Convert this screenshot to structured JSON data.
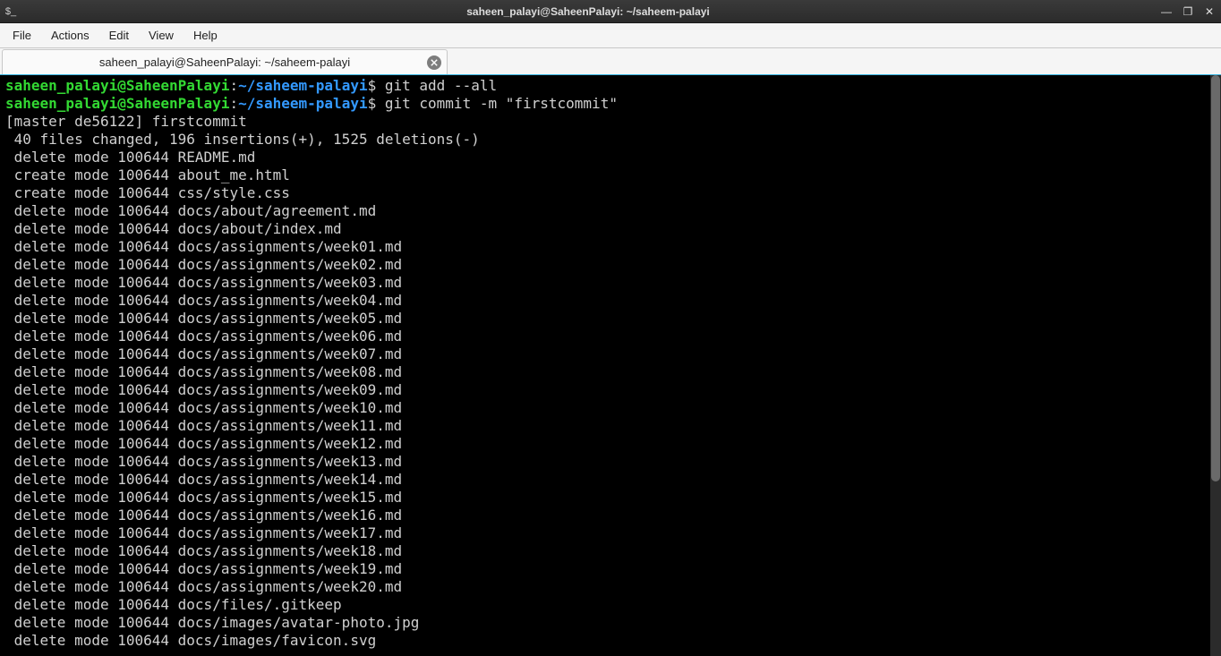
{
  "window_title": "saheen_palayi@SaheenPalayi: ~/saheem-palayi",
  "menubar": [
    {
      "label": "File"
    },
    {
      "label": "Actions"
    },
    {
      "label": "Edit"
    },
    {
      "label": "View"
    },
    {
      "label": "Help"
    }
  ],
  "tab": {
    "label": "saheen_palayi@SaheenPalayi: ~/saheem-palayi"
  },
  "prompt": {
    "user": "saheen_palayi",
    "host": "SaheenPalayi",
    "path": "~/saheem-palayi",
    "dollar": "$"
  },
  "commands": [
    "git add --all",
    "git commit -m \"firstcommit\""
  ],
  "output": [
    "[master de56122] firstcommit",
    " 40 files changed, 196 insertions(+), 1525 deletions(-)",
    " delete mode 100644 README.md",
    " create mode 100644 about_me.html",
    " create mode 100644 css/style.css",
    " delete mode 100644 docs/about/agreement.md",
    " delete mode 100644 docs/about/index.md",
    " delete mode 100644 docs/assignments/week01.md",
    " delete mode 100644 docs/assignments/week02.md",
    " delete mode 100644 docs/assignments/week03.md",
    " delete mode 100644 docs/assignments/week04.md",
    " delete mode 100644 docs/assignments/week05.md",
    " delete mode 100644 docs/assignments/week06.md",
    " delete mode 100644 docs/assignments/week07.md",
    " delete mode 100644 docs/assignments/week08.md",
    " delete mode 100644 docs/assignments/week09.md",
    " delete mode 100644 docs/assignments/week10.md",
    " delete mode 100644 docs/assignments/week11.md",
    " delete mode 100644 docs/assignments/week12.md",
    " delete mode 100644 docs/assignments/week13.md",
    " delete mode 100644 docs/assignments/week14.md",
    " delete mode 100644 docs/assignments/week15.md",
    " delete mode 100644 docs/assignments/week16.md",
    " delete mode 100644 docs/assignments/week17.md",
    " delete mode 100644 docs/assignments/week18.md",
    " delete mode 100644 docs/assignments/week19.md",
    " delete mode 100644 docs/assignments/week20.md",
    " delete mode 100644 docs/files/.gitkeep",
    " delete mode 100644 docs/images/avatar-photo.jpg",
    " delete mode 100644 docs/images/favicon.svg"
  ],
  "scrollbar": {
    "thumb_top_pct": 0,
    "thumb_height_pct": 70
  }
}
